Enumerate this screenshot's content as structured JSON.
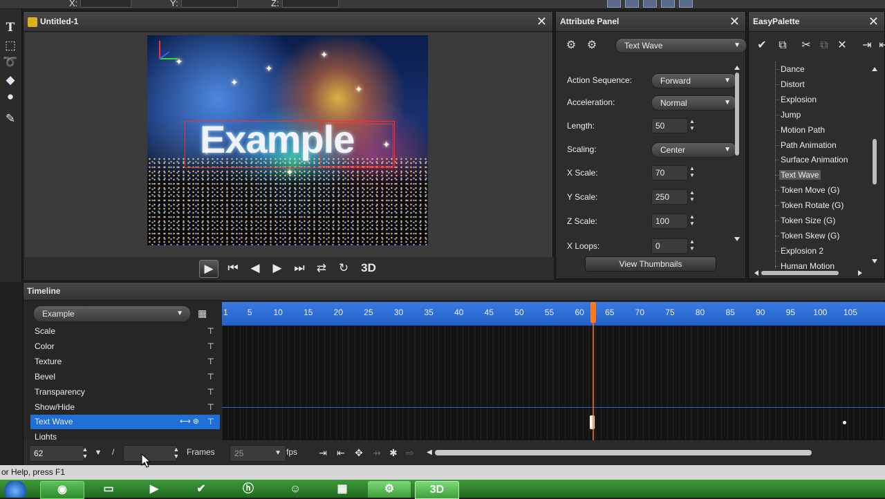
{
  "toolbar": {
    "x_label": "X:",
    "y_label": "Y:",
    "z_label": "Z:"
  },
  "lefttools": {
    "icons": [
      "text-tool-icon",
      "shape-tool-icon",
      "lasso-tool-icon",
      "fill-tool-icon",
      "light-tool-icon",
      "edit-tool-icon"
    ]
  },
  "viewport": {
    "title": "Untitled-1",
    "scene_text": "Example",
    "transport": {
      "three_d_label": "3D"
    }
  },
  "attribute_panel": {
    "title": "Attribute Panel",
    "effect": "Text Wave",
    "rows": [
      {
        "label": "Action Sequence:",
        "type": "dropdown",
        "value": "Forward"
      },
      {
        "label": "Acceleration:",
        "type": "dropdown",
        "value": "Normal"
      },
      {
        "label": "Length:",
        "type": "spin",
        "value": "50"
      },
      {
        "label": "Scaling:",
        "type": "dropdown",
        "value": "Center"
      },
      {
        "label": "X Scale:",
        "type": "spin",
        "value": "70"
      },
      {
        "label": "Y Scale:",
        "type": "spin",
        "value": "250"
      },
      {
        "label": "Z Scale:",
        "type": "spin",
        "value": "100"
      },
      {
        "label": "X Loops:",
        "type": "spin",
        "value": "0"
      }
    ],
    "view_thumbnails": "View Thumbnails"
  },
  "easy_palette": {
    "title": "EasyPalette",
    "items": [
      "Dance",
      "Distort",
      "Explosion",
      "Jump",
      "Motion Path",
      "Path Animation",
      "Surface Animation",
      "Text Wave",
      "Token Move (G)",
      "Token Rotate (G)",
      "Token Size (G)",
      "Token Skew (G)",
      "Explosion 2",
      "Human Motion"
    ],
    "selected": "Text Wave"
  },
  "timeline": {
    "title": "Timeline",
    "object": "Example",
    "tracks": [
      "Scale",
      "Color",
      "Texture",
      "Bevel",
      "Transparency",
      "Show/Hide",
      "Text Wave",
      "Lights"
    ],
    "selected_track": "Text Wave",
    "ruler": [
      "1",
      "5",
      "10",
      "15",
      "20",
      "25",
      "30",
      "35",
      "40",
      "45",
      "50",
      "55",
      "60",
      "65",
      "70",
      "75",
      "80",
      "85",
      "90",
      "95",
      "100",
      "105"
    ],
    "current_frame": "62",
    "total_frames": "",
    "frames_label": "Frames",
    "fps_value": "25",
    "fps_label": "fps",
    "slash": "/"
  },
  "status": {
    "text": "or Help, press F1"
  },
  "taskbar": {
    "apps": [
      "start-orb",
      "chrome",
      "folder",
      "media-player",
      "checkmark-app",
      "hp",
      "messenger",
      "media-app",
      "drive-app",
      "3d-app"
    ],
    "active_app_label": "3D"
  },
  "colors": {
    "accent": "#1f6fd6",
    "ruler": "#2f6ed8",
    "playhead": "#ff7a1a"
  }
}
